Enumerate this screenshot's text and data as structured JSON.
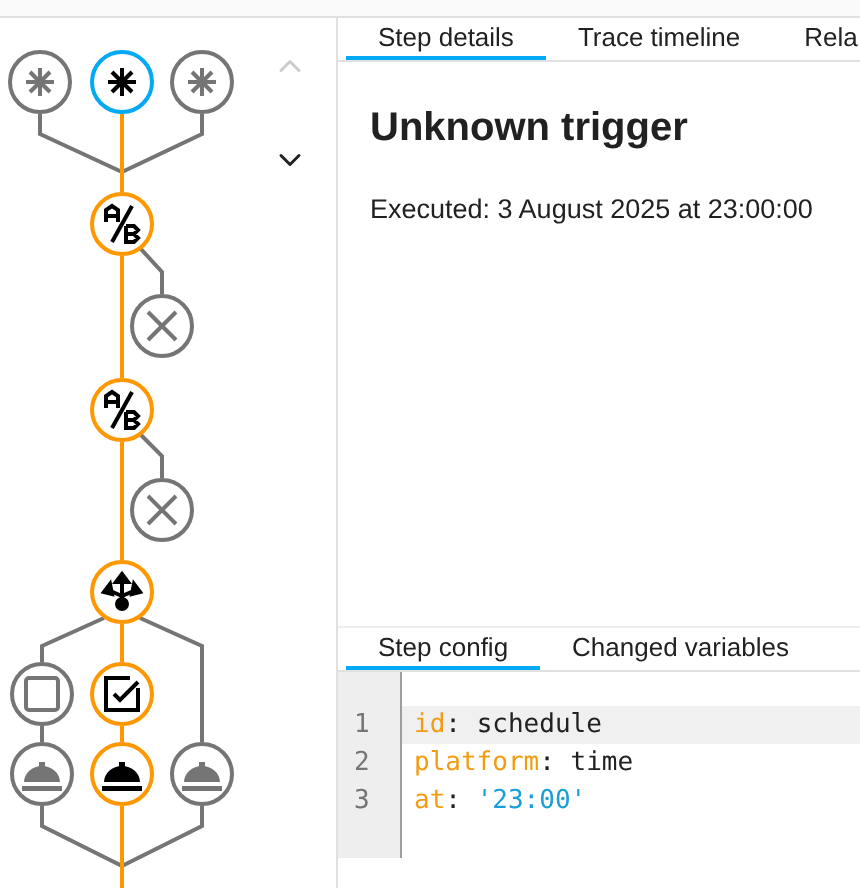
{
  "graph": {
    "nodes": [
      {
        "kind": "trigger",
        "selected": false,
        "active": false
      },
      {
        "kind": "trigger",
        "selected": true,
        "active": true
      },
      {
        "kind": "trigger",
        "selected": false,
        "active": false
      },
      {
        "kind": "choose",
        "selected": false,
        "active": true
      },
      {
        "kind": "stop",
        "selected": false,
        "active": false
      },
      {
        "kind": "choose",
        "selected": false,
        "active": true
      },
      {
        "kind": "stop",
        "selected": false,
        "active": false
      },
      {
        "kind": "parallel",
        "selected": false,
        "active": true
      },
      {
        "kind": "stopbox",
        "selected": false,
        "active": false
      },
      {
        "kind": "condition",
        "selected": false,
        "active": true
      },
      {
        "kind": "service",
        "selected": false,
        "active": false
      },
      {
        "kind": "service",
        "selected": false,
        "active": true
      },
      {
        "kind": "service",
        "selected": false,
        "active": false
      }
    ],
    "nav_buttons": [
      {
        "kind": "up",
        "disabled": true
      },
      {
        "kind": "down",
        "disabled": false
      }
    ]
  },
  "tabs": [
    {
      "label": "Step details",
      "selected": true
    },
    {
      "label": "Trace timeline",
      "selected": false
    },
    {
      "label": "Rela",
      "selected": false
    }
  ],
  "details": {
    "title": "Unknown trigger",
    "executed": "Executed: 3 August 2025 at 23:00:00"
  },
  "config_tabs": [
    {
      "label": "Step config",
      "selected": true
    },
    {
      "label": "Changed variables",
      "selected": false
    }
  ],
  "code": [
    {
      "number": "1",
      "selected": true,
      "tokens": [
        {
          "text": "id",
          "kind": "key"
        },
        {
          "text": ": ",
          "kind": "plain"
        },
        {
          "text": "schedule",
          "kind": "plain"
        }
      ]
    },
    {
      "number": "2",
      "selected": false,
      "tokens": [
        {
          "text": "platform",
          "kind": "key"
        },
        {
          "text": ": ",
          "kind": "plain"
        },
        {
          "text": "time",
          "kind": "plain"
        }
      ]
    },
    {
      "number": "3",
      "selected": false,
      "tokens": [
        {
          "text": "at",
          "kind": "key"
        },
        {
          "text": ": ",
          "kind": "plain"
        },
        {
          "text": "'23:00'",
          "kind": "string"
        }
      ]
    }
  ]
}
